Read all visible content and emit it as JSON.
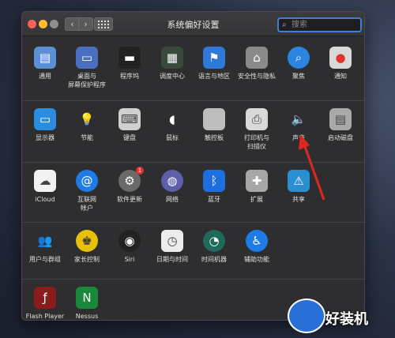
{
  "window": {
    "title": "系统偏好设置",
    "search_placeholder": "搜索"
  },
  "rows": [
    [
      {
        "label": "通用",
        "icon": "general-icon"
      },
      {
        "label": "桌面与\n屏幕保护程序",
        "icon": "desktop-icon"
      },
      {
        "label": "程序坞",
        "icon": "dock-icon"
      },
      {
        "label": "调度中心",
        "icon": "mission-control-icon"
      },
      {
        "label": "语言与地区",
        "icon": "language-icon"
      },
      {
        "label": "安全性与隐私",
        "icon": "security-icon"
      },
      {
        "label": "聚焦",
        "icon": "spotlight-icon"
      },
      {
        "label": "通知",
        "icon": "notifications-icon"
      }
    ],
    [
      {
        "label": "显示器",
        "icon": "display-icon"
      },
      {
        "label": "节能",
        "icon": "energy-icon"
      },
      {
        "label": "键盘",
        "icon": "keyboard-icon"
      },
      {
        "label": "鼠标",
        "icon": "mouse-icon"
      },
      {
        "label": "触控板",
        "icon": "trackpad-icon"
      },
      {
        "label": "打印机与\n扫描仪",
        "icon": "printer-icon"
      },
      {
        "label": "声音",
        "icon": "sound-icon"
      },
      {
        "label": "启动磁盘",
        "icon": "startup-disk-icon"
      }
    ],
    [
      {
        "label": "iCloud",
        "icon": "icloud-icon"
      },
      {
        "label": "互联网\n帐户",
        "icon": "internet-accounts-icon"
      },
      {
        "label": "软件更新",
        "icon": "software-update-icon",
        "badge": "1"
      },
      {
        "label": "网络",
        "icon": "network-icon"
      },
      {
        "label": "蓝牙",
        "icon": "bluetooth-icon"
      },
      {
        "label": "扩展",
        "icon": "extensions-icon"
      },
      {
        "label": "共享",
        "icon": "sharing-icon"
      }
    ],
    [
      {
        "label": "用户与群组",
        "icon": "users-icon"
      },
      {
        "label": "家长控制",
        "icon": "parental-controls-icon"
      },
      {
        "label": "Siri",
        "icon": "siri-icon"
      },
      {
        "label": "日期与时间",
        "icon": "date-time-icon"
      },
      {
        "label": "时间机器",
        "icon": "time-machine-icon"
      },
      {
        "label": "辅助功能",
        "icon": "accessibility-icon"
      }
    ],
    [
      {
        "label": "Flash Player",
        "icon": "flash-icon"
      },
      {
        "label": "Nessus",
        "icon": "nessus-icon"
      }
    ]
  ],
  "watermark": {
    "text": "好装机"
  },
  "colors": {
    "accent": "#3d7ee0",
    "arrow": "#e0271f"
  }
}
